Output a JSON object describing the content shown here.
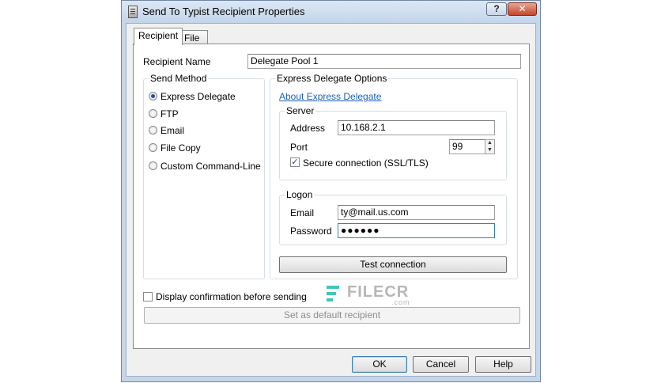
{
  "window": {
    "title": "Send To Typist Recipient Properties",
    "help": "?",
    "close": "✕"
  },
  "tabs": [
    {
      "label": "Recipient"
    },
    {
      "label": "File"
    }
  ],
  "recipient": {
    "name_label": "Recipient Name",
    "name_value": "Delegate Pool 1",
    "send_method": {
      "caption": "Send Method",
      "options": [
        "Express Delegate",
        "FTP",
        "Email",
        "File Copy",
        "Custom Command-Line"
      ],
      "selected": "Express Delegate"
    },
    "express": {
      "caption": "Express Delegate Options",
      "about_link": "About Express Delegate",
      "server": {
        "caption": "Server",
        "address_label": "Address",
        "address_value": "10.168.2.1",
        "port_label": "Port",
        "port_value": "99",
        "secure_label": "Secure connection (SSL/TLS)",
        "secure_checked": true
      },
      "logon": {
        "caption": "Logon",
        "email_label": "Email",
        "email_value": "ty@mail.us.com",
        "password_label": "Password",
        "password_value": "●●●●●●"
      },
      "test_button": "Test connection"
    },
    "confirm_label": "Display confirmation before sending",
    "default_button": "Set as default recipient"
  },
  "watermark": {
    "text": "FILECR",
    "sub": ".com"
  },
  "buttons": {
    "ok": "OK",
    "cancel": "Cancel",
    "help": "Help"
  }
}
